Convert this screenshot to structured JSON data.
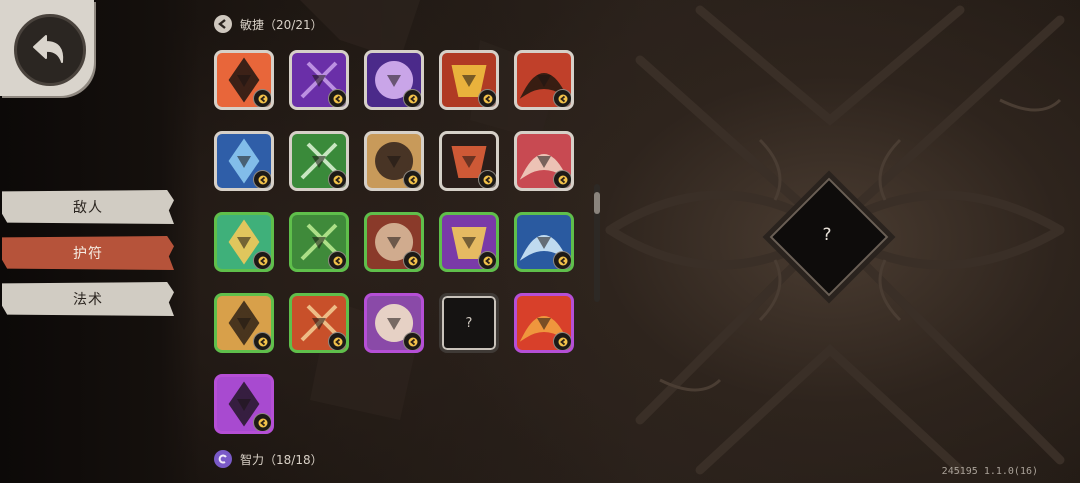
{
  "sidebar": {
    "tabs": [
      {
        "label": "敌人",
        "active": false
      },
      {
        "label": "护符",
        "active": true
      },
      {
        "label": "法术",
        "active": false
      }
    ]
  },
  "sections": {
    "agility": {
      "label": "敏捷（20/21）"
    },
    "intelligence": {
      "label": "智力（18/18）"
    }
  },
  "charms": [
    {
      "name": "candle-charm-icon",
      "rarity": "white",
      "colors": [
        "#e8663a",
        "#2a1a14"
      ]
    },
    {
      "name": "claw-charm-icon",
      "rarity": "white",
      "colors": [
        "#6a2fa8",
        "#c59be8"
      ]
    },
    {
      "name": "eye-charm-icon",
      "rarity": "white",
      "colors": [
        "#4b2a8a",
        "#d7b3f2"
      ]
    },
    {
      "name": "slash-charm-icon",
      "rarity": "white",
      "colors": [
        "#b03a24",
        "#f0c040"
      ]
    },
    {
      "name": "flame-mask-charm-icon",
      "rarity": "white",
      "colors": [
        "#c0402a",
        "#2a1a10"
      ]
    },
    {
      "name": "lightning-shield-charm-icon",
      "rarity": "white",
      "colors": [
        "#2f5ea8",
        "#8cc8f0"
      ]
    },
    {
      "name": "arrow-burst-charm-icon",
      "rarity": "white",
      "colors": [
        "#3a8a3a",
        "#d8f0d0"
      ]
    },
    {
      "name": "beast-shield-charm-icon",
      "rarity": "white",
      "colors": [
        "#c89a5a",
        "#3a2a20"
      ]
    },
    {
      "name": "demon-face-charm-icon",
      "rarity": "white",
      "colors": [
        "#2a1e1a",
        "#e0603a"
      ]
    },
    {
      "name": "wolf-head-charm-icon",
      "rarity": "white",
      "colors": [
        "#c84a52",
        "#f0d0c0"
      ]
    },
    {
      "name": "green-crystal-charm-icon",
      "rarity": "green",
      "colors": [
        "#3fb07a",
        "#f2c95a"
      ]
    },
    {
      "name": "leaf-arrow-charm-icon",
      "rarity": "green",
      "colors": [
        "#3f8a3a",
        "#b8e890"
      ]
    },
    {
      "name": "disc-charm-icon",
      "rarity": "green",
      "colors": [
        "#8a3a2a",
        "#d8b89a"
      ]
    },
    {
      "name": "scroll-charm-icon",
      "rarity": "green",
      "colors": [
        "#7a3aa8",
        "#f2c95a"
      ]
    },
    {
      "name": "storm-shield-charm-icon",
      "rarity": "green",
      "colors": [
        "#2a5aa0",
        "#d0e8f8"
      ]
    },
    {
      "name": "serpent-charm-icon",
      "rarity": "green",
      "colors": [
        "#d8a04a",
        "#3a2a1a"
      ]
    },
    {
      "name": "feather-charm-icon",
      "rarity": "green",
      "colors": [
        "#c8502a",
        "#f2c890"
      ]
    },
    {
      "name": "skull-charm-icon",
      "rarity": "purple",
      "colors": [
        "#8a4aa8",
        "#f0e0c8"
      ]
    },
    {
      "name": "locked-charm-icon",
      "rarity": "empty",
      "colors": [
        "#151312",
        "#cfc8bf"
      ],
      "label": "?"
    },
    {
      "name": "fire-orb-charm-icon",
      "rarity": "purple",
      "colors": [
        "#d8402a",
        "#f2a040"
      ]
    },
    {
      "name": "crossed-blades-charm-icon",
      "rarity": "purple",
      "colors": [
        "#a84ad0",
        "#2a1a30"
      ]
    }
  ],
  "detail": {
    "label": "?"
  },
  "version": "245195 1.1.0(16)",
  "colors": {
    "active_tab": "#b6533a",
    "inactive_tab": "#d1ccc3",
    "green_rarity": "#5fbf4b",
    "purple_rarity": "#b54fd6"
  }
}
